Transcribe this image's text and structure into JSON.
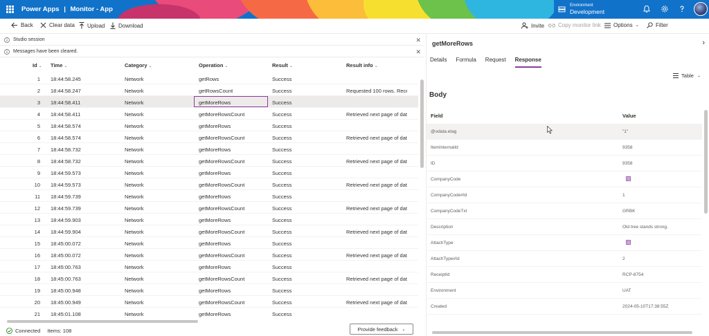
{
  "header": {
    "app_name": "Power Apps",
    "separator": "|",
    "page_name": "Monitor - App",
    "environment_label": "Environment",
    "environment_value": "Development"
  },
  "toolbar": {
    "back": "Back",
    "clear": "Clear data",
    "upload": "Upload",
    "download": "Download",
    "invite": "Invite",
    "copy_link": "Copy monitor link",
    "options": "Options",
    "filter": "Filter"
  },
  "notices": [
    {
      "text": "Studio session"
    },
    {
      "text": "Messages have been cleared."
    }
  ],
  "grid": {
    "columns": {
      "id": "Id",
      "time": "Time",
      "category": "Category",
      "operation": "Operation",
      "result": "Result",
      "result_info": "Result info"
    },
    "rows": [
      {
        "id": "1",
        "time": "18:44:58.245",
        "category": "Network",
        "operation": "getRows",
        "result": "Success",
        "info": ""
      },
      {
        "id": "2",
        "time": "18:44:58.247",
        "category": "Network",
        "operation": "getRowsCount",
        "result": "Success",
        "info": "Requested 100 rows. Recei"
      },
      {
        "id": "3",
        "time": "18:44:58.411",
        "category": "Network",
        "operation": "getMoreRows",
        "result": "Success",
        "info": ""
      },
      {
        "id": "4",
        "time": "18:44:58.411",
        "category": "Network",
        "operation": "getMoreRowsCount",
        "result": "Success",
        "info": "Retrieved next page of data"
      },
      {
        "id": "5",
        "time": "18:44:58.574",
        "category": "Network",
        "operation": "getMoreRows",
        "result": "Success",
        "info": ""
      },
      {
        "id": "6",
        "time": "18:44:58.574",
        "category": "Network",
        "operation": "getMoreRowsCount",
        "result": "Success",
        "info": "Retrieved next page of data"
      },
      {
        "id": "7",
        "time": "18:44:58.732",
        "category": "Network",
        "operation": "getMoreRows",
        "result": "Success",
        "info": ""
      },
      {
        "id": "8",
        "time": "18:44:58.732",
        "category": "Network",
        "operation": "getMoreRowsCount",
        "result": "Success",
        "info": "Retrieved next page of data"
      },
      {
        "id": "9",
        "time": "18:44:59.573",
        "category": "Network",
        "operation": "getMoreRows",
        "result": "Success",
        "info": ""
      },
      {
        "id": "10",
        "time": "18:44:59.573",
        "category": "Network",
        "operation": "getMoreRowsCount",
        "result": "Success",
        "info": "Retrieved next page of data"
      },
      {
        "id": "11",
        "time": "18:44:59.739",
        "category": "Network",
        "operation": "getMoreRows",
        "result": "Success",
        "info": ""
      },
      {
        "id": "12",
        "time": "18:44:59.739",
        "category": "Network",
        "operation": "getMoreRowsCount",
        "result": "Success",
        "info": "Retrieved next page of data"
      },
      {
        "id": "13",
        "time": "18:44:59.903",
        "category": "Network",
        "operation": "getMoreRows",
        "result": "Success",
        "info": ""
      },
      {
        "id": "14",
        "time": "18:44:59.904",
        "category": "Network",
        "operation": "getMoreRowsCount",
        "result": "Success",
        "info": "Retrieved next page of data"
      },
      {
        "id": "15",
        "time": "18:45:00.072",
        "category": "Network",
        "operation": "getMoreRows",
        "result": "Success",
        "info": ""
      },
      {
        "id": "16",
        "time": "18:45:00.072",
        "category": "Network",
        "operation": "getMoreRowsCount",
        "result": "Success",
        "info": "Retrieved next page of data"
      },
      {
        "id": "17",
        "time": "18:45:00.763",
        "category": "Network",
        "operation": "getMoreRows",
        "result": "Success",
        "info": ""
      },
      {
        "id": "18",
        "time": "18:45:00.763",
        "category": "Network",
        "operation": "getMoreRowsCount",
        "result": "Success",
        "info": "Retrieved next page of data"
      },
      {
        "id": "19",
        "time": "18:45:00.948",
        "category": "Network",
        "operation": "getMoreRows",
        "result": "Success",
        "info": ""
      },
      {
        "id": "20",
        "time": "18:45:00.949",
        "category": "Network",
        "operation": "getMoreRowsCount",
        "result": "Success",
        "info": "Retrieved next page of data"
      },
      {
        "id": "21",
        "time": "18:45:01.108",
        "category": "Network",
        "operation": "getMoreRows",
        "result": "Success",
        "info": ""
      }
    ]
  },
  "status": {
    "connected": "Connected",
    "items": "Items: 108",
    "feedback": "Provide feedback"
  },
  "details": {
    "title": "getMoreRows",
    "tabs": [
      "Details",
      "Formula",
      "Request",
      "Response"
    ],
    "active_tab": "Response",
    "view_mode": "Table",
    "body_title": "Body",
    "field_header": "Field",
    "value_header": "Value",
    "rows": [
      {
        "field": "@odata.etag",
        "value": "\"1\""
      },
      {
        "field": "ItemInternalId",
        "value": "9358"
      },
      {
        "field": "ID",
        "value": "9358"
      },
      {
        "field": "CompanyCode",
        "value": "",
        "icon": "table-icon"
      },
      {
        "field": "CompanyCode#Id",
        "value": "1"
      },
      {
        "field": "CompanyCodeTxt",
        "value": "GRBK"
      },
      {
        "field": "Description",
        "value": "Old tree stands strong."
      },
      {
        "field": "AttachType",
        "value": "",
        "icon": "table-icon"
      },
      {
        "field": "AttachType#Id",
        "value": "2"
      },
      {
        "field": "ReceiptId",
        "value": "RCP-8754"
      },
      {
        "field": "Environment",
        "value": "UAT"
      },
      {
        "field": "Created",
        "value": "2024-05-10T17:38:55Z"
      }
    ]
  },
  "colors": {
    "header_blue": "#1172c9",
    "accent_purple": "#8a3d9a",
    "success_green": "#107c10"
  }
}
